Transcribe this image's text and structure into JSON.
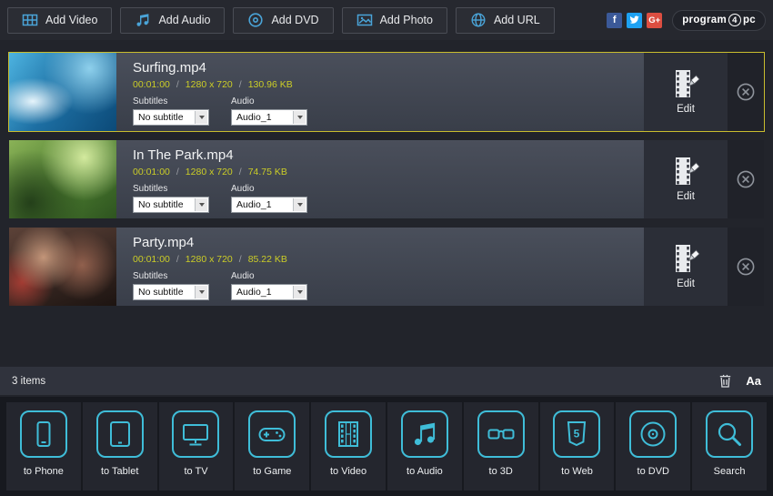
{
  "colors": {
    "accent-blue": "#4aa4d8",
    "accent-cyan": "#3fbdd8",
    "meta-yellow": "#cbcd27",
    "highlight-yellow": "#c9bd2e"
  },
  "toolbar": {
    "buttons": [
      {
        "label": "Add Video",
        "icon": "film-frames-icon"
      },
      {
        "label": "Add Audio",
        "icon": "music-note-icon"
      },
      {
        "label": "Add DVD",
        "icon": "disc-icon"
      },
      {
        "label": "Add Photo",
        "icon": "photo-icon"
      },
      {
        "label": "Add URL",
        "icon": "globe-icon"
      }
    ],
    "social": {
      "facebook": "f",
      "google": "G+"
    },
    "logo": {
      "part1": "program",
      "part2": "4",
      "part3": "pc"
    }
  },
  "list": {
    "sep": "/",
    "items": [
      {
        "title": "Surfing.mp4",
        "duration": "00:01:00",
        "resolution": "1280 x 720",
        "size": "130.96 KB",
        "subtitles_label": "Subtitles",
        "subtitles_value": "No subtitle",
        "audio_label": "Audio",
        "audio_value": "Audio_1",
        "edit_label": "Edit"
      },
      {
        "title": "In The Park.mp4",
        "duration": "00:01:00",
        "resolution": "1280 x 720",
        "size": "74.75 KB",
        "subtitles_label": "Subtitles",
        "subtitles_value": "No subtitle",
        "audio_label": "Audio",
        "audio_value": "Audio_1",
        "edit_label": "Edit"
      },
      {
        "title": "Party.mp4",
        "duration": "00:01:00",
        "resolution": "1280 x 720",
        "size": "85.22 KB",
        "subtitles_label": "Subtitles",
        "subtitles_value": "No subtitle",
        "audio_label": "Audio",
        "audio_value": "Audio_1",
        "edit_label": "Edit"
      }
    ]
  },
  "statusbar": {
    "count": "3 items",
    "text_size_label": "Aa"
  },
  "targets": [
    {
      "label": "to Phone",
      "icon": "phone-icon"
    },
    {
      "label": "to Tablet",
      "icon": "tablet-icon"
    },
    {
      "label": "to TV",
      "icon": "tv-icon"
    },
    {
      "label": "to Game",
      "icon": "gamepad-icon"
    },
    {
      "label": "to Video",
      "icon": "filmstrip-icon"
    },
    {
      "label": "to Audio",
      "icon": "music-notes-icon"
    },
    {
      "label": "to 3D",
      "icon": "3d-glasses-icon"
    },
    {
      "label": "to Web",
      "icon": "html5-shield-icon"
    },
    {
      "label": "to DVD",
      "icon": "dvd-disc-icon"
    },
    {
      "label": "Search",
      "icon": "magnifier-icon"
    }
  ]
}
